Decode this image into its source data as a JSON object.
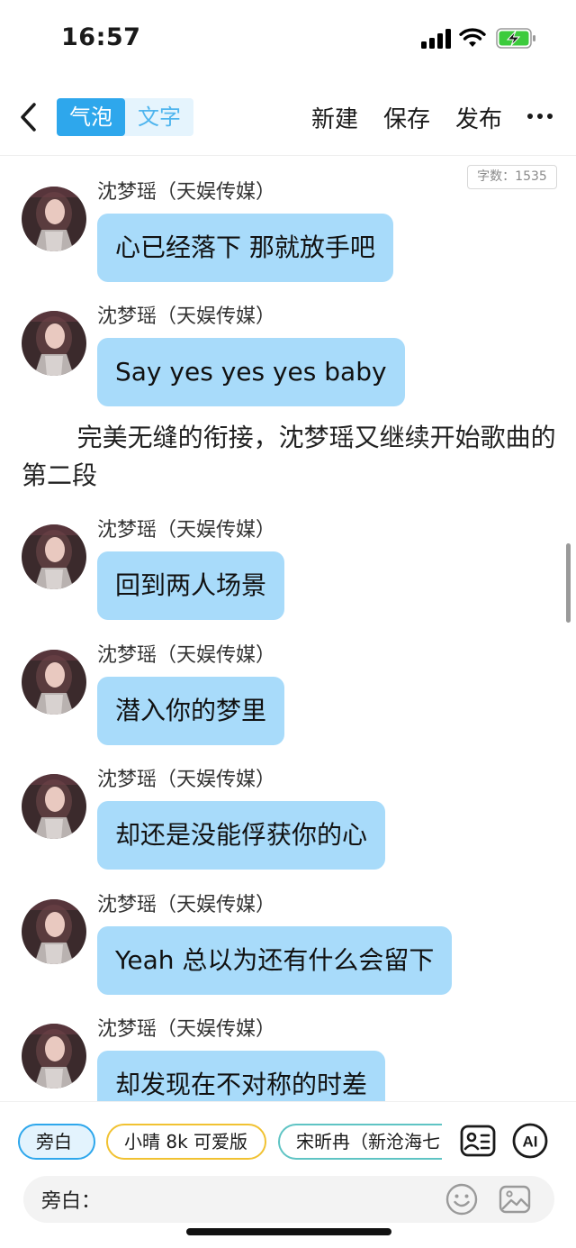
{
  "status_bar": {
    "time": "16:57"
  },
  "nav": {
    "tabs": [
      "气泡",
      "文字"
    ],
    "actions": [
      "新建",
      "保存",
      "发布"
    ]
  },
  "word_count": "字数：1535",
  "messages": [
    {
      "sender": "沈梦瑶（天娱传媒）",
      "text": "心已经落下 那就放手吧"
    },
    {
      "sender": "沈梦瑶（天娱传媒）",
      "text": "Say yes yes yes baby"
    },
    {
      "sender": "沈梦瑶（天娱传媒）",
      "text": "回到两人场景"
    },
    {
      "sender": "沈梦瑶（天娱传媒）",
      "text": "潜入你的梦里"
    },
    {
      "sender": "沈梦瑶（天娱传媒）",
      "text": "却还是没能俘获你的心"
    },
    {
      "sender": "沈梦瑶（天娱传媒）",
      "text": "Yeah 总以为还有什么会留下"
    },
    {
      "sender": "沈梦瑶（天娱传媒）",
      "text": "却发现在不对称的时差"
    }
  ],
  "narration": "完美无缝的衔接，沈梦瑶又继续开始歌曲的第二段",
  "bottom": {
    "roles": [
      "旁白",
      "小晴 8k 可爱版",
      "宋昕冉（新沧海七"
    ],
    "ai_label": "AI",
    "input_label": "旁白："
  },
  "colors": {
    "accent": "#2ea7ec",
    "bubble": "#a8dbfa",
    "chip_yellow": "#f1c232",
    "chip_teal": "#5fc4c4"
  }
}
